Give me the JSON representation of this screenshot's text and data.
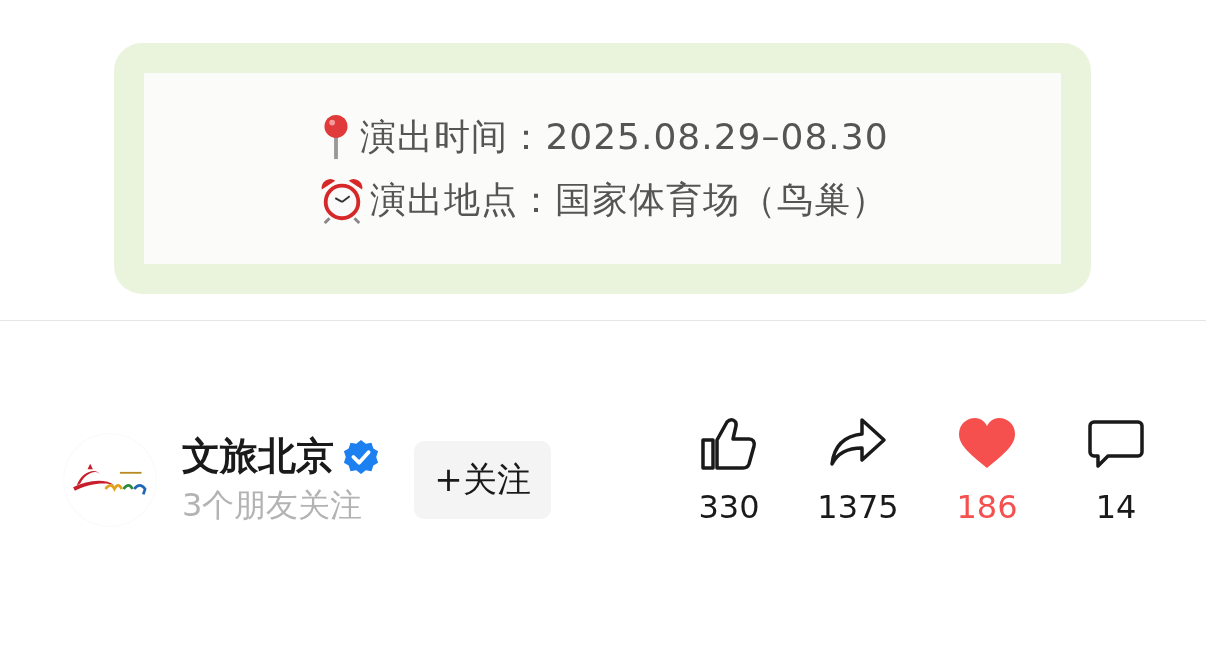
{
  "info_card": {
    "lines": [
      {
        "kind": "pin",
        "text": "演出时间：2025.08.29–08.30"
      },
      {
        "kind": "clock",
        "text": "演出地点：国家体育场（鸟巢）"
      }
    ]
  },
  "author": {
    "name": "文旅北京",
    "verified": true,
    "subtitle": "3个朋友关注",
    "follow_button": "+关注"
  },
  "actions": [
    {
      "kind": "like",
      "count": "330",
      "selected": false
    },
    {
      "kind": "share",
      "count": "1375",
      "selected": false
    },
    {
      "kind": "favorite",
      "count": "186",
      "selected": true
    },
    {
      "kind": "comment",
      "count": "14",
      "selected": false
    }
  ]
}
